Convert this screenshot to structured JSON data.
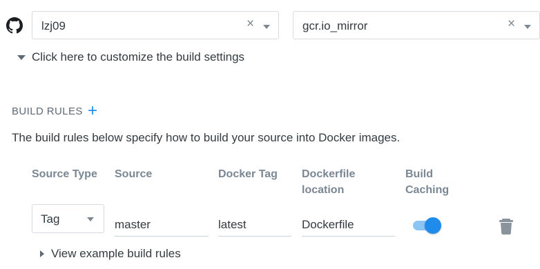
{
  "source": {
    "provider_icon": "github-icon",
    "organization": {
      "value": "lzj09",
      "clear_glyph": "×"
    },
    "repository": {
      "value": "gcr.io_mirror",
      "clear_glyph": "×"
    }
  },
  "customize": {
    "label": "Click here to customize the build settings"
  },
  "build_rules": {
    "title": "BUILD RULES",
    "add_glyph": "+",
    "description": "The build rules below specify how to build your source into Docker images.",
    "columns": {
      "source_type": "Source Type",
      "source": "Source",
      "docker_tag": "Docker Tag",
      "dockerfile_line1": "Dockerfile",
      "dockerfile_line2": "location",
      "caching_line1": "Build",
      "caching_line2": "Caching"
    },
    "rows": [
      {
        "source_type": "Tag",
        "source": "master",
        "docker_tag": "latest",
        "dockerfile_location": "Dockerfile",
        "build_caching": true
      }
    ],
    "examples_link": "View example build rules"
  },
  "colors": {
    "accent": "#1f8ceb",
    "header_text": "#7a8793"
  }
}
